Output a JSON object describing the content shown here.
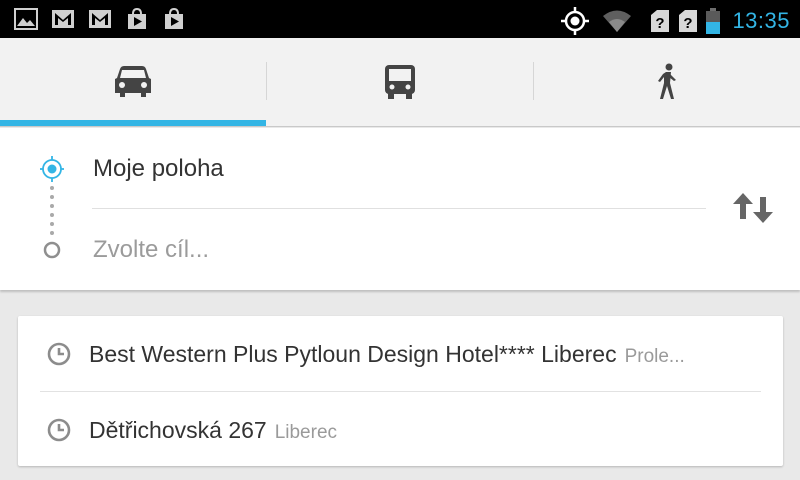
{
  "status_bar": {
    "left_icons": [
      "gallery-icon",
      "gmail-icon",
      "gmail-icon",
      "play-store-icon",
      "play-store-icon"
    ],
    "right_icons": [
      "gps-icon",
      "wifi-icon",
      "no-sim-icon",
      "no-sim-icon",
      "battery-icon"
    ],
    "time": "13:35",
    "time_color": "#33b5e5"
  },
  "mode_tabs": {
    "items": [
      {
        "icon": "car-icon",
        "selected": true
      },
      {
        "icon": "bus-icon",
        "selected": false
      },
      {
        "icon": "walk-icon",
        "selected": false
      }
    ],
    "indicator_color": "#33b5e5"
  },
  "route": {
    "origin": "Moje poloha",
    "destination_placeholder": "Zvolte cíl..."
  },
  "history": {
    "items": [
      {
        "title": "Best Western Plus Pytloun Design Hotel**** Liberec",
        "subtitle": "Prole..."
      },
      {
        "title": "Dětřichovská 267",
        "subtitle": "Liberec"
      }
    ]
  }
}
